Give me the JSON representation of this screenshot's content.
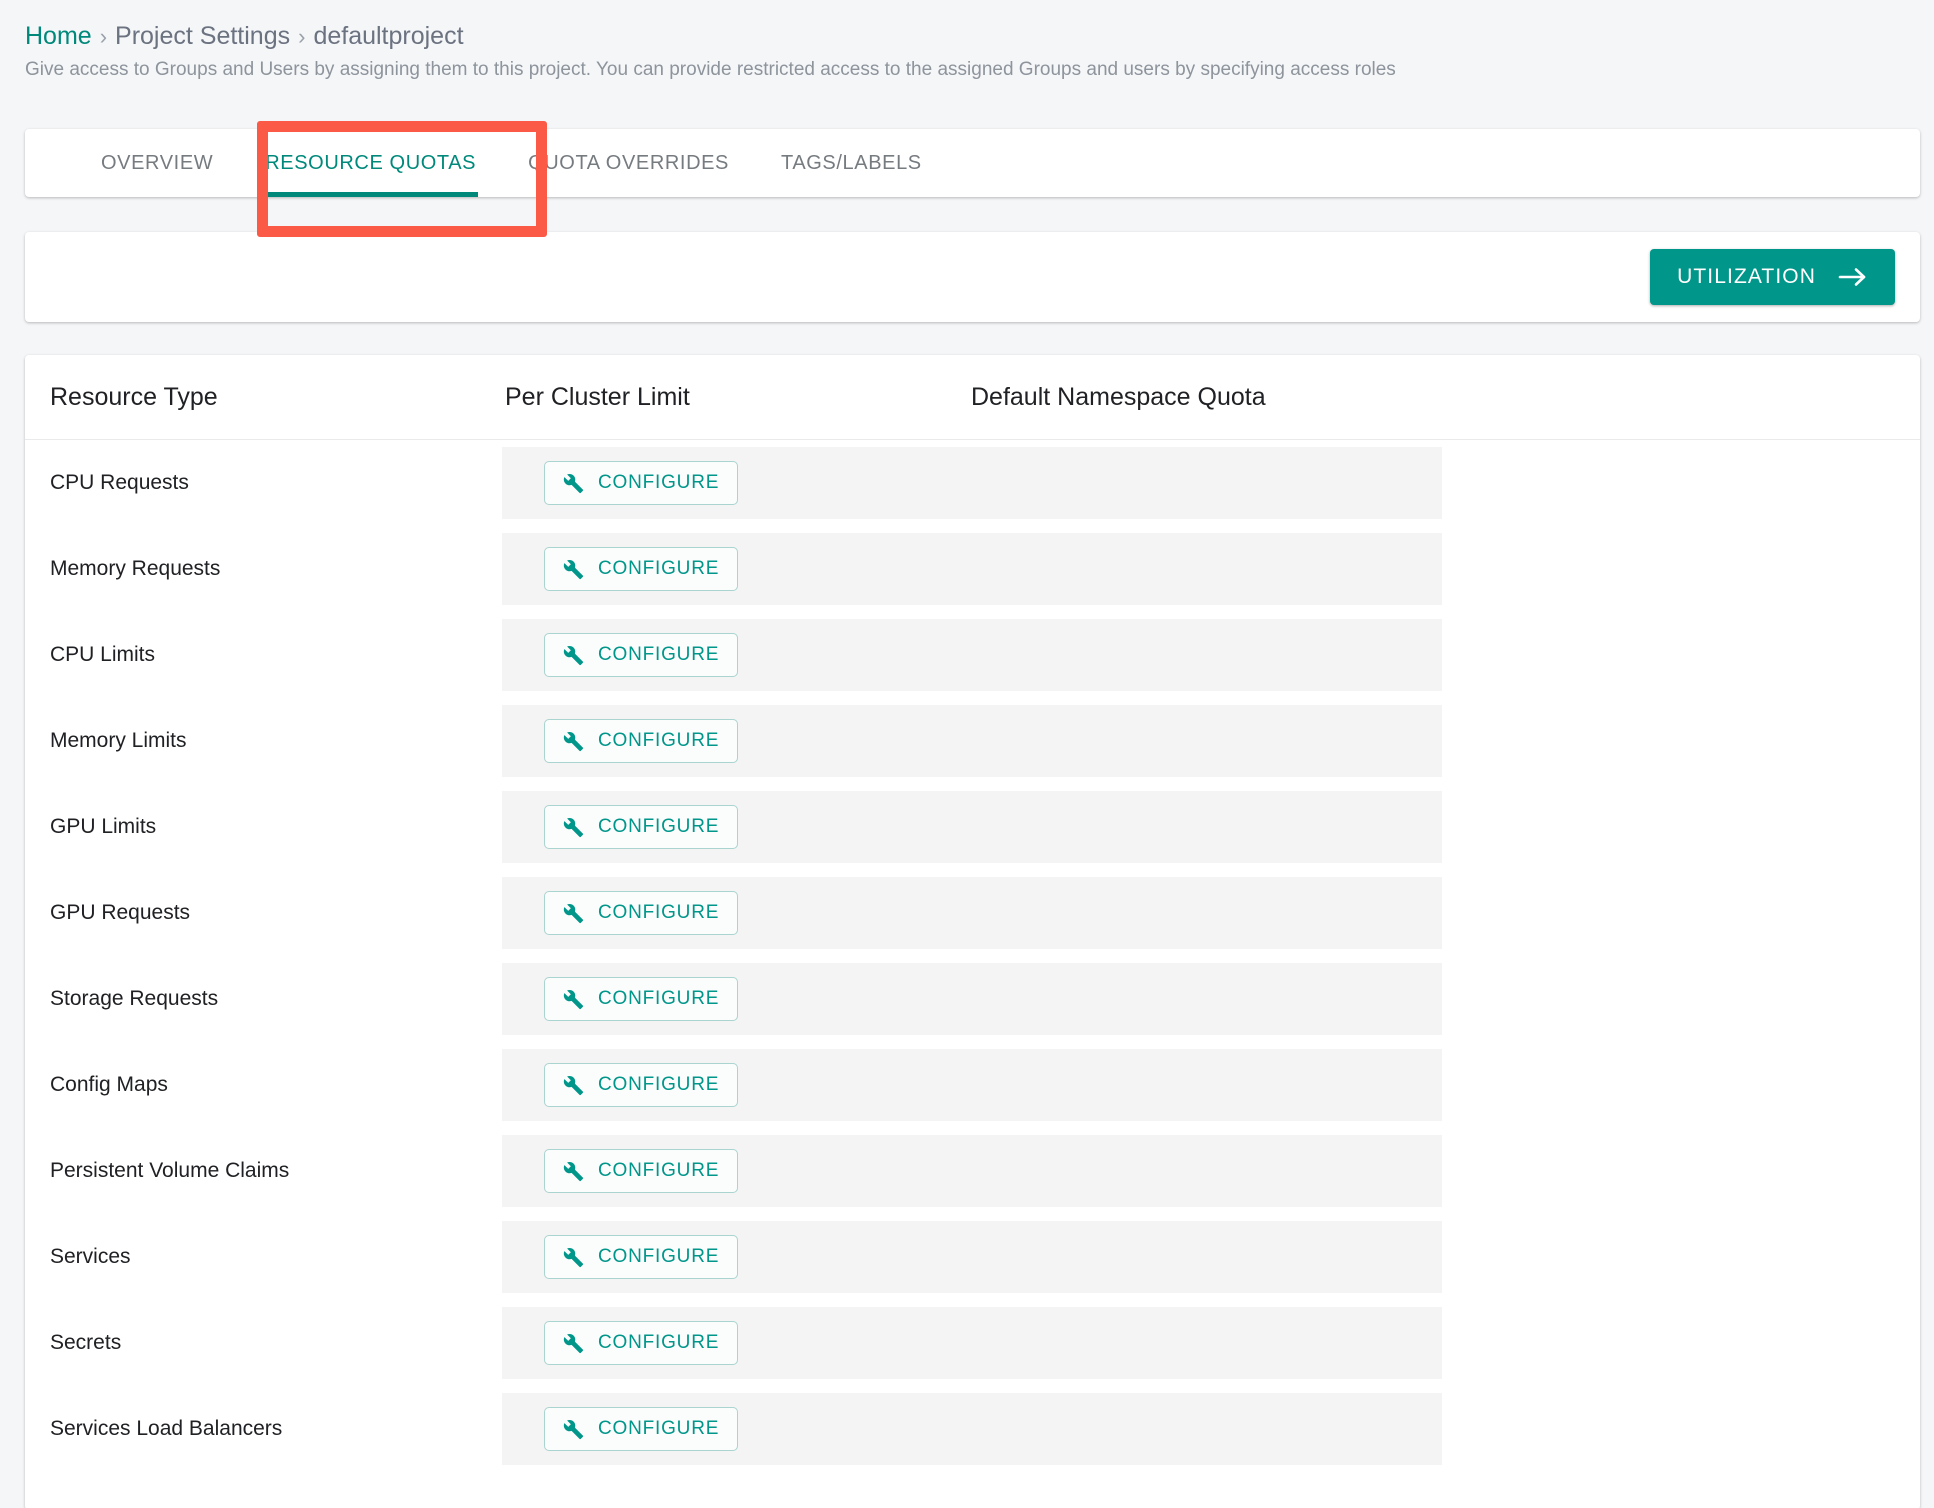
{
  "breadcrumb": {
    "home": "Home",
    "separator": "›",
    "section": "Project Settings",
    "current": "defaultproject"
  },
  "subtitle": "Give access to Groups and Users by assigning them to this project. You can provide restricted access to the assigned Groups and users by specifying access roles",
  "tabs": [
    {
      "label": "OVERVIEW",
      "active": false
    },
    {
      "label": "RESOURCE QUOTAS",
      "active": true
    },
    {
      "label": "QUOTA OVERRIDES",
      "active": false
    },
    {
      "label": "TAGS/LABELS",
      "active": false
    }
  ],
  "toolbar": {
    "utilization_label": "UTILIZATION",
    "arrow_icon": "arrow-right-icon"
  },
  "table": {
    "columns": [
      "Resource Type",
      "Per Cluster Limit",
      "Default Namespace Quota"
    ],
    "configure_label": "CONFIGURE",
    "configure_icon": "wrench-icon",
    "rows": [
      {
        "resource_type": "CPU Requests",
        "per_cluster_limit": "CONFIGURE",
        "default_namespace_quota": ""
      },
      {
        "resource_type": "Memory Requests",
        "per_cluster_limit": "CONFIGURE",
        "default_namespace_quota": ""
      },
      {
        "resource_type": "CPU Limits",
        "per_cluster_limit": "CONFIGURE",
        "default_namespace_quota": ""
      },
      {
        "resource_type": "Memory Limits",
        "per_cluster_limit": "CONFIGURE",
        "default_namespace_quota": ""
      },
      {
        "resource_type": "GPU Limits",
        "per_cluster_limit": "CONFIGURE",
        "default_namespace_quota": ""
      },
      {
        "resource_type": "GPU Requests",
        "per_cluster_limit": "CONFIGURE",
        "default_namespace_quota": ""
      },
      {
        "resource_type": "Storage Requests",
        "per_cluster_limit": "CONFIGURE",
        "default_namespace_quota": ""
      },
      {
        "resource_type": "Config Maps",
        "per_cluster_limit": "CONFIGURE",
        "default_namespace_quota": ""
      },
      {
        "resource_type": "Persistent Volume Claims",
        "per_cluster_limit": "CONFIGURE",
        "default_namespace_quota": ""
      },
      {
        "resource_type": "Services",
        "per_cluster_limit": "CONFIGURE",
        "default_namespace_quota": ""
      },
      {
        "resource_type": "Secrets",
        "per_cluster_limit": "CONFIGURE",
        "default_namespace_quota": ""
      },
      {
        "resource_type": "Services Load Balancers",
        "per_cluster_limit": "CONFIGURE",
        "default_namespace_quota": ""
      }
    ]
  },
  "annotation": {
    "target": "RESOURCE QUOTAS",
    "color": "#fb5a47"
  },
  "colors": {
    "accent_teal": "#00968a",
    "link_teal": "#00897b",
    "page_background": "#f5f6f8",
    "row_band": "#f4f4f5",
    "text_primary": "#202124",
    "text_muted": "#8d949c"
  }
}
